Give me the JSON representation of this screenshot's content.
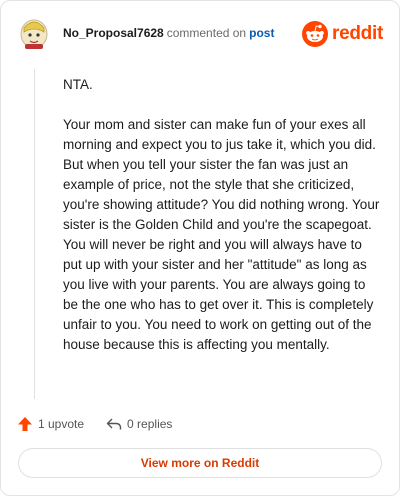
{
  "comment": {
    "username": "No_Proposal7628",
    "action_text": "commented on",
    "post_link": "post",
    "avatar_icon": "cartoon-avatar-icon",
    "paragraphs": [
      "NTA.",
      "Your mom and sister can make fun of your exes all morning and expect you to jus take it, which you did. But when you tell your sister the fan was just an example of price, not the style that she criticized, you're showing attitude? You did nothing wrong. Your sister is the Golden Child and you're the scapegoat. You will never be right and you will always have to put up with your sister and her \"attitude\" as long as you live with your parents. You are always going to be the one who has to get over it. This is completely unfair to you. You need to work on getting out of the house because this is affecting you mentally."
    ]
  },
  "brand": {
    "name": "reddit",
    "icon": "reddit-logo-icon",
    "color": "#ff4500"
  },
  "footer": {
    "upvote_label": "1 upvote",
    "upvote_icon": "upvote-arrow-icon",
    "replies_label": "0 replies",
    "reply_icon": "reply-arrow-icon"
  },
  "view_more_label": "View more on Reddit",
  "colors": {
    "accent": "#ff4500",
    "link": "#0a5bb4",
    "view_more": "#d93a00"
  }
}
